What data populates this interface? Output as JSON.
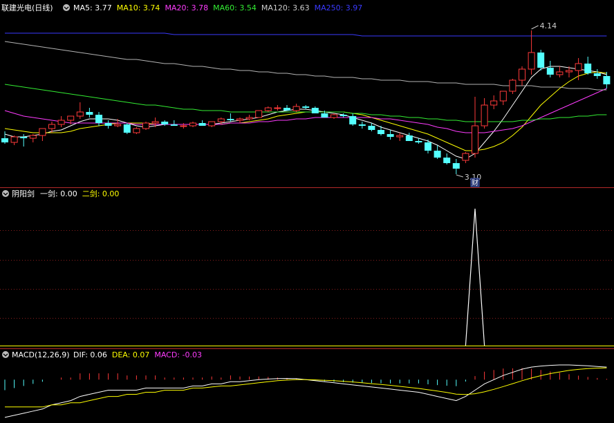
{
  "colors": {
    "bg": "#000000",
    "up": "#ff3a3a",
    "down": "#54ffff",
    "divider": "#b42a2a",
    "grid": "#8c1e1e",
    "ma5": "#ffffff",
    "ma10": "#ffff00",
    "ma20": "#ff3cff",
    "ma60": "#33ee33",
    "ma120": "#b4b4b4",
    "ma250": "#3a3aff",
    "header_label": "#ffffff",
    "signal": "#ffffff",
    "jian2": "#ffff00"
  },
  "main_panel": {
    "title": "联建光电(日线)",
    "indicators": [
      {
        "label": "MA5: 3.77",
        "color": "#ffffff"
      },
      {
        "label": "MA10: 3.74",
        "color": "#ffff00"
      },
      {
        "label": "MA20: 3.78",
        "color": "#ff3cff"
      },
      {
        "label": "MA60: 3.54",
        "color": "#33ee33"
      },
      {
        "label": "MA120: 3.63",
        "color": "#cccccc"
      },
      {
        "label": "MA250: 3.97",
        "color": "#3a3aff"
      }
    ],
    "high_label": "4.14",
    "low_label": "3.10",
    "badge": "财"
  },
  "signal_panel": {
    "title": "阴阳剑",
    "indicators": [
      {
        "label": "一剑: 0.00",
        "color": "#ffffff"
      },
      {
        "label": "二剑: 0.00",
        "color": "#ffff00"
      }
    ]
  },
  "macd_panel": {
    "title": "MACD(12,26,9)",
    "indicators": [
      {
        "label": "DIF: 0.06",
        "color": "#ffffff"
      },
      {
        "label": "DEA: 0.07",
        "color": "#ffff00"
      },
      {
        "label": "MACD: -0.03",
        "color": "#ff3cff"
      }
    ]
  },
  "chart_data": {
    "type": "candlestick",
    "ylim": [
      3.05,
      4.2
    ],
    "candles": [
      [
        3.36,
        3.41,
        3.32,
        3.33
      ],
      [
        3.33,
        3.38,
        3.31,
        3.37
      ],
      [
        3.37,
        3.39,
        3.3,
        3.36
      ],
      [
        3.36,
        3.39,
        3.33,
        3.38
      ],
      [
        3.38,
        3.43,
        3.34,
        3.43
      ],
      [
        3.43,
        3.48,
        3.4,
        3.46
      ],
      [
        3.46,
        3.52,
        3.44,
        3.49
      ],
      [
        3.49,
        3.52,
        3.46,
        3.52
      ],
      [
        3.52,
        3.62,
        3.5,
        3.55
      ],
      [
        3.55,
        3.58,
        3.51,
        3.53
      ],
      [
        3.53,
        3.55,
        3.45,
        3.47
      ],
      [
        3.47,
        3.49,
        3.43,
        3.45
      ],
      [
        3.45,
        3.5,
        3.44,
        3.46
      ],
      [
        3.46,
        3.47,
        3.39,
        3.4
      ],
      [
        3.4,
        3.44,
        3.39,
        3.43
      ],
      [
        3.43,
        3.48,
        3.42,
        3.47
      ],
      [
        3.47,
        3.51,
        3.44,
        3.48
      ],
      [
        3.48,
        3.49,
        3.45,
        3.46
      ],
      [
        3.46,
        3.49,
        3.45,
        3.45
      ],
      [
        3.45,
        3.47,
        3.43,
        3.45
      ],
      [
        3.45,
        3.48,
        3.44,
        3.47
      ],
      [
        3.47,
        3.49,
        3.45,
        3.45
      ],
      [
        3.45,
        3.48,
        3.44,
        3.48
      ],
      [
        3.48,
        3.51,
        3.46,
        3.5
      ],
      [
        3.5,
        3.54,
        3.48,
        3.49
      ],
      [
        3.49,
        3.51,
        3.47,
        3.5
      ],
      [
        3.5,
        3.53,
        3.49,
        3.51
      ],
      [
        3.51,
        3.56,
        3.51,
        3.56
      ],
      [
        3.56,
        3.59,
        3.55,
        3.58
      ],
      [
        3.58,
        3.6,
        3.56,
        3.58
      ],
      [
        3.58,
        3.6,
        3.56,
        3.56
      ],
      [
        3.56,
        3.61,
        3.55,
        3.59
      ],
      [
        3.59,
        3.6,
        3.57,
        3.58
      ],
      [
        3.58,
        3.59,
        3.54,
        3.54
      ],
      [
        3.54,
        3.56,
        3.51,
        3.51
      ],
      [
        3.51,
        3.54,
        3.5,
        3.53
      ],
      [
        3.53,
        3.54,
        3.51,
        3.52
      ],
      [
        3.52,
        3.54,
        3.45,
        3.46
      ],
      [
        3.46,
        3.48,
        3.43,
        3.45
      ],
      [
        3.45,
        3.47,
        3.41,
        3.42
      ],
      [
        3.42,
        3.45,
        3.38,
        3.39
      ],
      [
        3.39,
        3.42,
        3.35,
        3.37
      ],
      [
        3.37,
        3.4,
        3.34,
        3.38
      ],
      [
        3.38,
        3.4,
        3.34,
        3.34
      ],
      [
        3.34,
        3.36,
        3.32,
        3.33
      ],
      [
        3.33,
        3.35,
        3.25,
        3.27
      ],
      [
        3.27,
        3.31,
        3.21,
        3.22
      ],
      [
        3.22,
        3.25,
        3.17,
        3.18
      ],
      [
        3.18,
        3.21,
        3.1,
        3.14
      ],
      [
        3.2,
        3.26,
        3.18,
        3.25
      ],
      [
        3.25,
        3.66,
        3.22,
        3.45
      ],
      [
        3.45,
        3.65,
        3.43,
        3.6
      ],
      [
        3.6,
        3.67,
        3.57,
        3.63
      ],
      [
        3.63,
        3.7,
        3.6,
        3.7
      ],
      [
        3.7,
        3.79,
        3.68,
        3.78
      ],
      [
        3.78,
        3.88,
        3.74,
        3.86
      ],
      [
        3.86,
        4.14,
        3.82,
        3.98
      ],
      [
        3.98,
        4.0,
        3.85,
        3.87
      ],
      [
        3.87,
        3.92,
        3.8,
        3.82
      ],
      [
        3.82,
        3.88,
        3.8,
        3.84
      ],
      [
        3.84,
        3.88,
        3.8,
        3.85
      ],
      [
        3.85,
        3.94,
        3.78,
        3.9
      ],
      [
        3.9,
        3.95,
        3.82,
        3.83
      ],
      [
        3.83,
        3.86,
        3.79,
        3.81
      ],
      [
        3.81,
        3.84,
        3.72,
        3.75
      ]
    ],
    "ma": [
      {
        "name": "MA5",
        "values": [
          3.39,
          3.37,
          3.37,
          3.38,
          3.39,
          3.41,
          3.42,
          3.45,
          3.48,
          3.5,
          3.5,
          3.5,
          3.49,
          3.47,
          3.45,
          3.44,
          3.45,
          3.46,
          3.46,
          3.46,
          3.46,
          3.46,
          3.46,
          3.47,
          3.48,
          3.49,
          3.5,
          3.51,
          3.53,
          3.55,
          3.56,
          3.57,
          3.57,
          3.56,
          3.55,
          3.54,
          3.53,
          3.51,
          3.49,
          3.47,
          3.44,
          3.42,
          3.4,
          3.38,
          3.36,
          3.34,
          3.31,
          3.27,
          3.23,
          3.21,
          3.25,
          3.33,
          3.41,
          3.5,
          3.6,
          3.7,
          3.8,
          3.86,
          3.88,
          3.88,
          3.87,
          3.86,
          3.85,
          3.84,
          3.82
        ]
      },
      {
        "name": "MA10",
        "values": [
          3.43,
          3.42,
          3.41,
          3.4,
          3.4,
          3.4,
          3.4,
          3.41,
          3.43,
          3.44,
          3.45,
          3.46,
          3.47,
          3.47,
          3.47,
          3.47,
          3.46,
          3.46,
          3.46,
          3.46,
          3.46,
          3.46,
          3.46,
          3.46,
          3.47,
          3.47,
          3.48,
          3.49,
          3.5,
          3.52,
          3.53,
          3.54,
          3.55,
          3.55,
          3.55,
          3.55,
          3.55,
          3.54,
          3.53,
          3.51,
          3.49,
          3.47,
          3.45,
          3.43,
          3.41,
          3.39,
          3.36,
          3.33,
          3.3,
          3.27,
          3.27,
          3.28,
          3.3,
          3.33,
          3.38,
          3.44,
          3.52,
          3.6,
          3.66,
          3.72,
          3.77,
          3.81,
          3.83,
          3.84,
          3.83
        ]
      },
      {
        "name": "MA20",
        "values": [
          3.56,
          3.54,
          3.52,
          3.51,
          3.5,
          3.49,
          3.48,
          3.47,
          3.47,
          3.47,
          3.47,
          3.47,
          3.47,
          3.47,
          3.46,
          3.46,
          3.46,
          3.46,
          3.46,
          3.46,
          3.46,
          3.46,
          3.46,
          3.46,
          3.47,
          3.47,
          3.47,
          3.48,
          3.48,
          3.49,
          3.49,
          3.5,
          3.5,
          3.51,
          3.51,
          3.51,
          3.51,
          3.51,
          3.51,
          3.51,
          3.5,
          3.5,
          3.49,
          3.48,
          3.47,
          3.46,
          3.44,
          3.43,
          3.41,
          3.4,
          3.4,
          3.4,
          3.41,
          3.42,
          3.43,
          3.45,
          3.48,
          3.51,
          3.54,
          3.57,
          3.6,
          3.63,
          3.66,
          3.69,
          3.72
        ]
      },
      {
        "name": "MA60",
        "values": [
          3.75,
          3.74,
          3.73,
          3.72,
          3.71,
          3.7,
          3.69,
          3.68,
          3.67,
          3.66,
          3.65,
          3.64,
          3.63,
          3.62,
          3.61,
          3.6,
          3.6,
          3.59,
          3.58,
          3.57,
          3.57,
          3.56,
          3.56,
          3.56,
          3.55,
          3.55,
          3.55,
          3.55,
          3.55,
          3.55,
          3.55,
          3.55,
          3.55,
          3.55,
          3.55,
          3.55,
          3.55,
          3.54,
          3.54,
          3.53,
          3.53,
          3.52,
          3.52,
          3.51,
          3.51,
          3.5,
          3.5,
          3.49,
          3.49,
          3.48,
          3.48,
          3.48,
          3.48,
          3.48,
          3.48,
          3.49,
          3.49,
          3.5,
          3.5,
          3.51,
          3.51,
          3.52,
          3.52,
          3.53,
          3.53
        ]
      },
      {
        "name": "MA120",
        "values": [
          4.06,
          4.05,
          4.04,
          4.03,
          4.02,
          4.01,
          4.0,
          3.99,
          3.98,
          3.97,
          3.96,
          3.95,
          3.94,
          3.93,
          3.93,
          3.92,
          3.91,
          3.9,
          3.9,
          3.89,
          3.88,
          3.88,
          3.87,
          3.86,
          3.86,
          3.85,
          3.85,
          3.84,
          3.84,
          3.83,
          3.83,
          3.82,
          3.82,
          3.81,
          3.81,
          3.8,
          3.8,
          3.8,
          3.79,
          3.79,
          3.78,
          3.78,
          3.78,
          3.77,
          3.77,
          3.77,
          3.76,
          3.76,
          3.76,
          3.75,
          3.75,
          3.75,
          3.75,
          3.74,
          3.74,
          3.74,
          3.74,
          3.73,
          3.73,
          3.73,
          3.72,
          3.72,
          3.72,
          3.71,
          3.71
        ]
      },
      {
        "name": "MA250",
        "values": [
          4.12,
          4.12,
          4.12,
          4.12,
          4.12,
          4.12,
          4.12,
          4.12,
          4.12,
          4.12,
          4.12,
          4.12,
          4.12,
          4.12,
          4.12,
          4.12,
          4.12,
          4.12,
          4.11,
          4.11,
          4.11,
          4.11,
          4.11,
          4.11,
          4.11,
          4.11,
          4.11,
          4.11,
          4.11,
          4.11,
          4.11,
          4.11,
          4.11,
          4.11,
          4.11,
          4.11,
          4.11,
          4.11,
          4.1,
          4.1,
          4.1,
          4.1,
          4.1,
          4.1,
          4.1,
          4.1,
          4.1,
          4.1,
          4.1,
          4.1,
          4.1,
          4.1,
          4.1,
          4.1,
          4.1,
          4.1,
          4.1,
          4.1,
          4.1,
          4.1,
          4.1,
          4.1,
          4.1,
          4.1,
          4.1
        ]
      }
    ],
    "signal": {
      "spike_index": 50,
      "spike_value": 1.0,
      "ylim": [
        0,
        1.05
      ]
    },
    "macd": {
      "ylim": [
        -0.2,
        0.08
      ],
      "dif": [
        -0.18,
        -0.17,
        -0.16,
        -0.15,
        -0.14,
        -0.12,
        -0.11,
        -0.1,
        -0.08,
        -0.07,
        -0.06,
        -0.05,
        -0.05,
        -0.05,
        -0.05,
        -0.04,
        -0.04,
        -0.04,
        -0.04,
        -0.04,
        -0.03,
        -0.03,
        -0.02,
        -0.02,
        -0.01,
        -0.01,
        -0.005,
        0.0,
        0.003,
        0.005,
        0.006,
        0.005,
        0.0,
        -0.005,
        -0.01,
        -0.015,
        -0.02,
        -0.025,
        -0.03,
        -0.035,
        -0.04,
        -0.045,
        -0.05,
        -0.055,
        -0.06,
        -0.07,
        -0.08,
        -0.09,
        -0.1,
        -0.08,
        -0.05,
        -0.02,
        0.0,
        0.02,
        0.035,
        0.05,
        0.06,
        0.065,
        0.068,
        0.07,
        0.07,
        0.068,
        0.066,
        0.063,
        0.06
      ],
      "dea": [
        -0.13,
        -0.13,
        -0.13,
        -0.13,
        -0.13,
        -0.12,
        -0.12,
        -0.11,
        -0.11,
        -0.1,
        -0.09,
        -0.08,
        -0.08,
        -0.07,
        -0.07,
        -0.06,
        -0.06,
        -0.05,
        -0.05,
        -0.05,
        -0.04,
        -0.04,
        -0.035,
        -0.03,
        -0.03,
        -0.025,
        -0.02,
        -0.015,
        -0.01,
        -0.005,
        -0.002,
        0.0,
        0.0,
        -0.001,
        -0.003,
        -0.005,
        -0.008,
        -0.011,
        -0.015,
        -0.019,
        -0.023,
        -0.027,
        -0.032,
        -0.037,
        -0.042,
        -0.048,
        -0.054,
        -0.061,
        -0.069,
        -0.071,
        -0.067,
        -0.058,
        -0.046,
        -0.033,
        -0.019,
        -0.005,
        0.008,
        0.019,
        0.029,
        0.037,
        0.044,
        0.049,
        0.053,
        0.055,
        0.056
      ],
      "hist": [
        -0.05,
        -0.04,
        -0.03,
        -0.02,
        -0.01,
        0.0,
        0.01,
        0.01,
        0.03,
        0.03,
        0.03,
        0.03,
        0.03,
        0.02,
        0.02,
        0.02,
        0.02,
        0.01,
        0.01,
        0.01,
        0.01,
        0.01,
        0.015,
        0.01,
        0.02,
        0.015,
        0.015,
        0.015,
        0.013,
        0.01,
        0.008,
        0.005,
        0.0,
        -0.004,
        -0.007,
        -0.01,
        -0.012,
        -0.014,
        -0.015,
        -0.016,
        -0.017,
        -0.018,
        -0.018,
        -0.018,
        -0.018,
        -0.022,
        -0.026,
        -0.029,
        -0.031,
        -0.009,
        0.017,
        0.038,
        0.046,
        0.053,
        0.054,
        0.055,
        0.052,
        0.046,
        0.039,
        0.033,
        0.026,
        0.019,
        0.013,
        0.008,
        0.004
      ]
    }
  }
}
